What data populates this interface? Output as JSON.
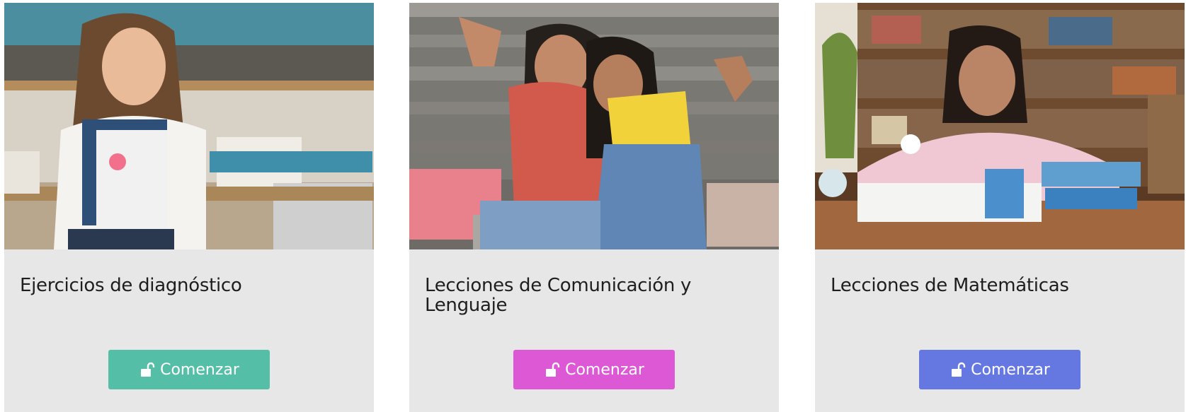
{
  "cards": [
    {
      "title": "Ejercicios de diagnóstico",
      "button_label": "Comenzar",
      "button_icon": "unlock-icon",
      "button_color": "#55bea6",
      "image": "girl-holding-notebooks-photo"
    },
    {
      "title": "Lecciones de Comunicación y Lenguaje",
      "button_label": "Comenzar",
      "button_icon": "unlock-icon",
      "button_color": "#dc58d5",
      "image": "two-girls-peace-sign-photo"
    },
    {
      "title": "Lecciones de Matemáticas",
      "button_label": "Comenzar",
      "button_icon": "unlock-icon",
      "button_color": "#6577e1",
      "image": "girl-studying-at-desk-photo"
    }
  ]
}
